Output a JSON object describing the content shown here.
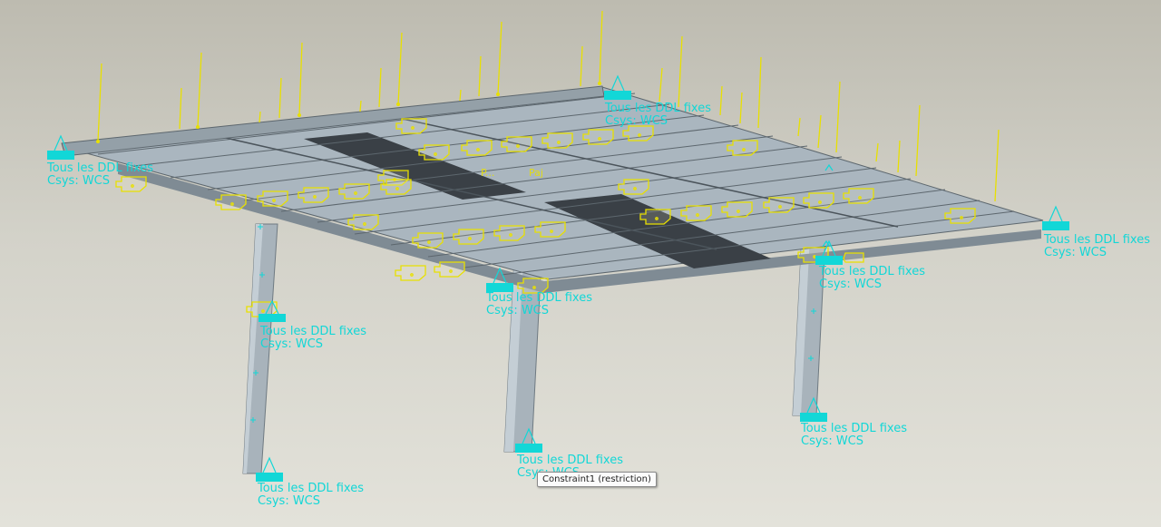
{
  "constraint_text": {
    "line1": "Tous les DDL fixes",
    "line2": "Csys: WCS"
  },
  "beam_labels": [
    "P...",
    "Paj"
  ],
  "tooltip": "Constraint1 (restriction)",
  "colors": {
    "constraint": "#12d7d7",
    "load": "#e8e000",
    "beam_top": "#aab6bf",
    "beam_side": "#7f8b94",
    "opening": "#3a4046"
  },
  "icons": {
    "constraint": "fixed-support-icon",
    "load": "force-arrow-icon",
    "local_csys": "beam-section-icon"
  }
}
